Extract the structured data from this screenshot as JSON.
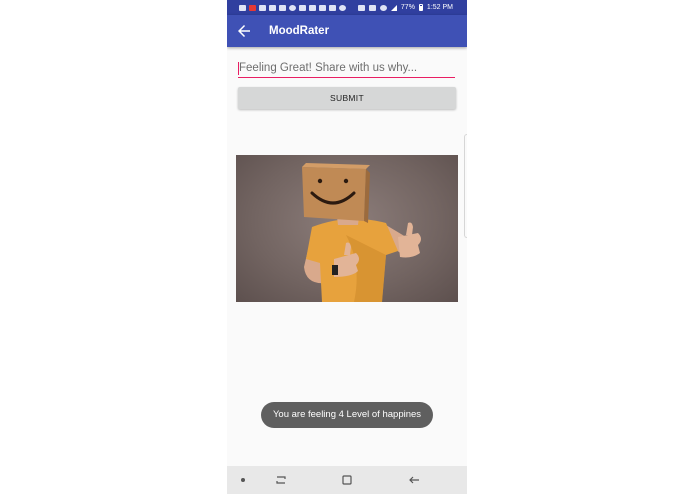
{
  "status_bar": {
    "battery": "77%",
    "time": "1:52 PM"
  },
  "app_bar": {
    "title": "MoodRater"
  },
  "form": {
    "input_placeholder": "Feeling Great! Share with us why...",
    "submit_label": "SUBMIT"
  },
  "toast": {
    "message": "You are feeling 4 Level of happines"
  },
  "colors": {
    "primary": "#3f51b5",
    "primary_dark": "#303f9f",
    "accent": "#e91e63"
  },
  "icons": [
    "back-arrow-icon",
    "recent-apps-icon",
    "home-icon",
    "back-nav-icon"
  ]
}
